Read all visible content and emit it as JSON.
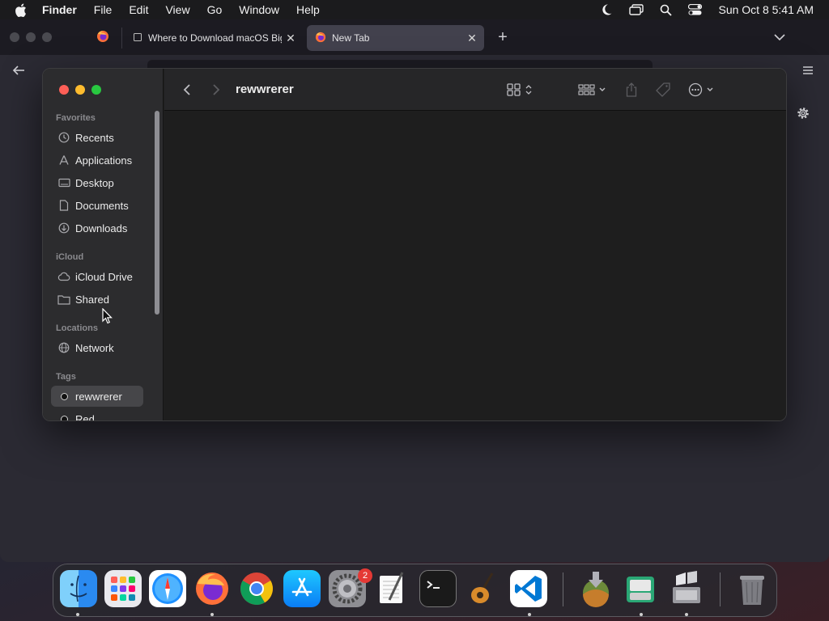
{
  "menubar": {
    "app_name": "Finder",
    "items": [
      "File",
      "Edit",
      "View",
      "Go",
      "Window",
      "Help"
    ],
    "clock": "Sun Oct 8  5:41 AM",
    "status_icons": [
      "moon-icon",
      "screen-mirroring-icon",
      "spotlight-icon",
      "control-center-icon"
    ]
  },
  "browser": {
    "tabs": [
      {
        "title": "Where to Download macOS Big",
        "active": false
      },
      {
        "title": "New Tab",
        "active": true
      }
    ],
    "new_tab_label": "+"
  },
  "finder": {
    "title": "rewwrerer",
    "sidebar": {
      "favorites_label": "Favorites",
      "favorites": [
        {
          "label": "Recents",
          "icon": "clock-icon"
        },
        {
          "label": "Applications",
          "icon": "applications-icon"
        },
        {
          "label": "Desktop",
          "icon": "desktop-icon"
        },
        {
          "label": "Documents",
          "icon": "document-icon"
        },
        {
          "label": "Downloads",
          "icon": "download-icon"
        }
      ],
      "icloud_label": "iCloud",
      "icloud": [
        {
          "label": "iCloud Drive",
          "icon": "cloud-icon"
        },
        {
          "label": "Shared",
          "icon": "shared-folder-icon"
        }
      ],
      "locations_label": "Locations",
      "locations": [
        {
          "label": "Network",
          "icon": "globe-icon"
        }
      ],
      "tags_label": "Tags",
      "tags": [
        {
          "label": "rewwrerer",
          "selected": true
        },
        {
          "label": "Red",
          "selected": false
        }
      ]
    }
  },
  "dock": {
    "apps": [
      "Finder",
      "Launchpad",
      "Safari",
      "Firefox",
      "Chrome",
      "App Store",
      "System Settings",
      "TextEdit",
      "Terminal",
      "GarageBand",
      "Visual Studio Code",
      "Install macOS",
      "Archive Utility",
      "Boot Camp Assistant",
      "Trash"
    ],
    "system_settings_badge": "2"
  }
}
